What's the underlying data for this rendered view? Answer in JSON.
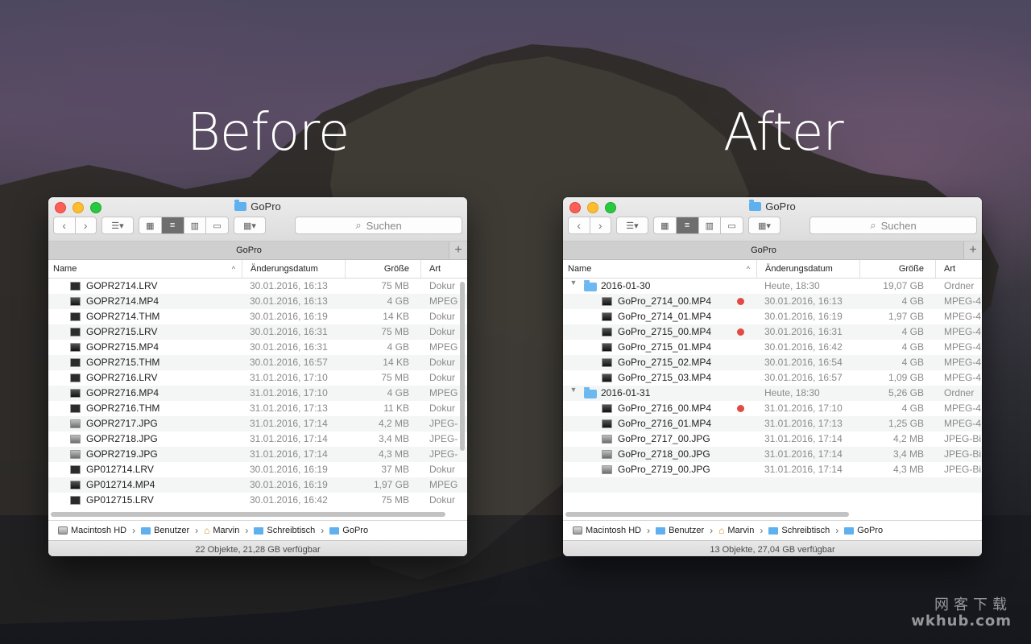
{
  "labels": {
    "before": "Before",
    "after": "After"
  },
  "watermark": {
    "line1": "网客下载",
    "line2": "wkhub.com"
  },
  "before": {
    "title": "GoPro",
    "search_placeholder": "Suchen",
    "tab": "GoPro",
    "columns": {
      "name": "Name",
      "date": "Änderungsdatum",
      "size": "Größe",
      "kind": "Art"
    },
    "rows": [
      {
        "name": "GOPR2714.LRV",
        "date": "30.01.2016, 16:13",
        "size": "75 MB",
        "kind": "Dokur",
        "icon": "document-icon"
      },
      {
        "name": "GOPR2714.MP4",
        "date": "30.01.2016, 16:13",
        "size": "4 GB",
        "kind": "MPEG",
        "icon": "movie-icon"
      },
      {
        "name": "GOPR2714.THM",
        "date": "30.01.2016, 16:19",
        "size": "14 KB",
        "kind": "Dokur",
        "icon": "document-icon"
      },
      {
        "name": "GOPR2715.LRV",
        "date": "30.01.2016, 16:31",
        "size": "75 MB",
        "kind": "Dokur",
        "icon": "document-icon"
      },
      {
        "name": "GOPR2715.MP4",
        "date": "30.01.2016, 16:31",
        "size": "4 GB",
        "kind": "MPEG",
        "icon": "movie-icon"
      },
      {
        "name": "GOPR2715.THM",
        "date": "30.01.2016, 16:57",
        "size": "14 KB",
        "kind": "Dokur",
        "icon": "document-icon"
      },
      {
        "name": "GOPR2716.LRV",
        "date": "31.01.2016, 17:10",
        "size": "75 MB",
        "kind": "Dokur",
        "icon": "document-icon"
      },
      {
        "name": "GOPR2716.MP4",
        "date": "31.01.2016, 17:10",
        "size": "4 GB",
        "kind": "MPEG",
        "icon": "movie-icon"
      },
      {
        "name": "GOPR2716.THM",
        "date": "31.01.2016, 17:13",
        "size": "11 KB",
        "kind": "Dokur",
        "icon": "document-icon"
      },
      {
        "name": "GOPR2717.JPG",
        "date": "31.01.2016, 17:14",
        "size": "4,2 MB",
        "kind": "JPEG-",
        "icon": "image-icon"
      },
      {
        "name": "GOPR2718.JPG",
        "date": "31.01.2016, 17:14",
        "size": "3,4 MB",
        "kind": "JPEG-",
        "icon": "image-icon"
      },
      {
        "name": "GOPR2719.JPG",
        "date": "31.01.2016, 17:14",
        "size": "4,3 MB",
        "kind": "JPEG-",
        "icon": "image-icon"
      },
      {
        "name": "GP012714.LRV",
        "date": "30.01.2016, 16:19",
        "size": "37 MB",
        "kind": "Dokur",
        "icon": "document-icon"
      },
      {
        "name": "GP012714.MP4",
        "date": "30.01.2016, 16:19",
        "size": "1,97 GB",
        "kind": "MPEG",
        "icon": "movie-icon"
      },
      {
        "name": "GP012715.LRV",
        "date": "30.01.2016, 16:42",
        "size": "75 MB",
        "kind": "Dokur",
        "icon": "document-icon"
      }
    ],
    "path": [
      "Macintosh HD",
      "Benutzer",
      "Marvin",
      "Schreibtisch",
      "GoPro"
    ],
    "status": "22 Objekte, 21,28 GB verfügbar"
  },
  "after": {
    "title": "GoPro",
    "search_placeholder": "Suchen",
    "tab": "GoPro",
    "columns": {
      "name": "Name",
      "date": "Änderungsdatum",
      "size": "Größe",
      "kind": "Art"
    },
    "rows": [
      {
        "type": "folder",
        "name": "2016-01-30",
        "date": "Heute, 18:30",
        "size": "19,07 GB",
        "kind": "Ordner"
      },
      {
        "type": "file",
        "name": "GoPro_2714_00.MP4",
        "date": "30.01.2016, 16:13",
        "size": "4 GB",
        "kind": "MPEG-4",
        "tag": true,
        "icon": "movie-icon"
      },
      {
        "type": "file",
        "name": "GoPro_2714_01.MP4",
        "date": "30.01.2016, 16:19",
        "size": "1,97 GB",
        "kind": "MPEG-4",
        "tag": false,
        "icon": "movie-icon"
      },
      {
        "type": "file",
        "name": "GoPro_2715_00.MP4",
        "date": "30.01.2016, 16:31",
        "size": "4 GB",
        "kind": "MPEG-4",
        "tag": true,
        "icon": "movie-icon"
      },
      {
        "type": "file",
        "name": "GoPro_2715_01.MP4",
        "date": "30.01.2016, 16:42",
        "size": "4 GB",
        "kind": "MPEG-4",
        "tag": false,
        "icon": "movie-icon"
      },
      {
        "type": "file",
        "name": "GoPro_2715_02.MP4",
        "date": "30.01.2016, 16:54",
        "size": "4 GB",
        "kind": "MPEG-4",
        "tag": false,
        "icon": "movie-icon"
      },
      {
        "type": "file",
        "name": "GoPro_2715_03.MP4",
        "date": "30.01.2016, 16:57",
        "size": "1,09 GB",
        "kind": "MPEG-4",
        "tag": false,
        "icon": "movie-icon"
      },
      {
        "type": "folder",
        "name": "2016-01-31",
        "date": "Heute, 18:30",
        "size": "5,26 GB",
        "kind": "Ordner"
      },
      {
        "type": "file",
        "name": "GoPro_2716_00.MP4",
        "date": "31.01.2016, 17:10",
        "size": "4 GB",
        "kind": "MPEG-4",
        "tag": true,
        "icon": "movie-icon"
      },
      {
        "type": "file",
        "name": "GoPro_2716_01.MP4",
        "date": "31.01.2016, 17:13",
        "size": "1,25 GB",
        "kind": "MPEG-4",
        "tag": false,
        "icon": "movie-icon"
      },
      {
        "type": "file",
        "name": "GoPro_2717_00.JPG",
        "date": "31.01.2016, 17:14",
        "size": "4,2 MB",
        "kind": "JPEG-Bi",
        "tag": false,
        "icon": "image-icon"
      },
      {
        "type": "file",
        "name": "GoPro_2718_00.JPG",
        "date": "31.01.2016, 17:14",
        "size": "3,4 MB",
        "kind": "JPEG-Bi",
        "tag": false,
        "icon": "image-icon"
      },
      {
        "type": "file",
        "name": "GoPro_2719_00.JPG",
        "date": "31.01.2016, 17:14",
        "size": "4,3 MB",
        "kind": "JPEG-Bi",
        "tag": false,
        "icon": "image-icon"
      }
    ],
    "path": [
      "Macintosh HD",
      "Benutzer",
      "Marvin",
      "Schreibtisch",
      "GoPro"
    ],
    "status": "13 Objekte, 27,04 GB verfügbar"
  },
  "colors": {
    "tag_red": "#e34a44",
    "folder_blue": "#6cb8f0",
    "active_view": "#6e6e6e"
  }
}
